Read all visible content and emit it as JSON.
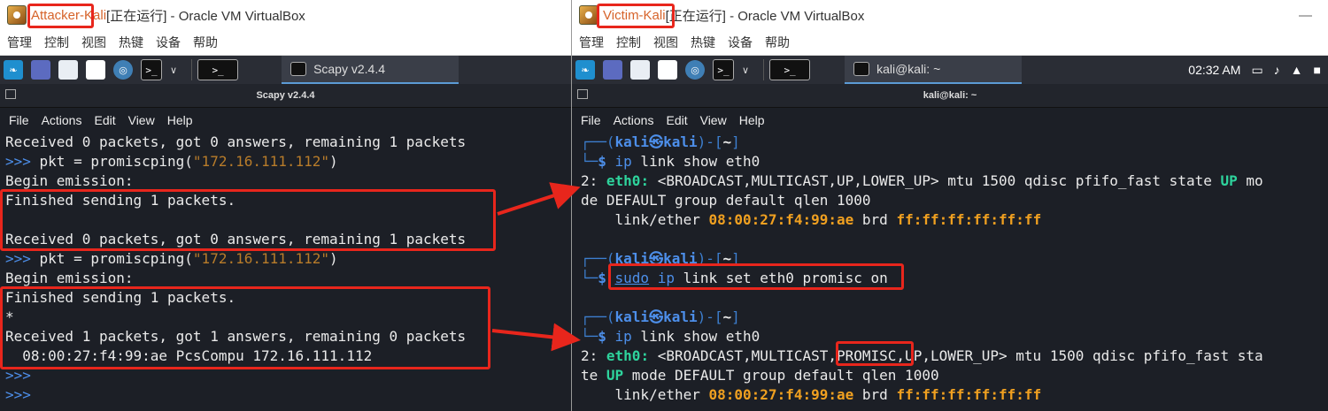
{
  "left": {
    "vm_name": "Attacker-Kali",
    "title_rest": " [正在运行] - Oracle VM VirtualBox",
    "menu": [
      "管理",
      "控制",
      "视图",
      "热键",
      "设备",
      "帮助"
    ],
    "task_label": "Scapy v2.4.4",
    "term_title": "Scapy v2.4.4",
    "term_menu": [
      "File",
      "Actions",
      "Edit",
      "View",
      "Help"
    ],
    "lines": {
      "l1": "Received 0 packets, got 0 answers, remaining 1 packets",
      "l2_prompt": ">>> ",
      "l2_a": "pkt = promiscping(",
      "l2_str": "\"172.16.111.112\"",
      "l2_b": ")",
      "l3": "Begin emission:",
      "l4": "Finished sending 1 packets.",
      "l5": "",
      "l6": "Received 0 packets, got 0 answers, remaining 1 packets",
      "l7_prompt": ">>> ",
      "l7_a": "pkt = promiscping(",
      "l7_str": "\"172.16.111.112\"",
      "l7_b": ")",
      "l8": "Begin emission:",
      "l9": "Finished sending 1 packets.",
      "l10": "*",
      "l11": "Received 1 packets, got 1 answers, remaining 0 packets",
      "l12": "  08:00:27:f4:99:ae PcsCompu 172.16.111.112",
      "l13": ">>>",
      "l14": ">>>"
    }
  },
  "right": {
    "vm_name": "Victim-Kali",
    "title_rest": " [正在运行] - Oracle VM VirtualBox",
    "minimize": "—",
    "menu": [
      "管理",
      "控制",
      "视图",
      "热键",
      "设备",
      "帮助"
    ],
    "task_label": "kali@kali: ~",
    "clock": "02:32 AM",
    "term_title": "kali@kali: ~",
    "term_menu": [
      "File",
      "Actions",
      "Edit",
      "View",
      "Help"
    ],
    "prompt_top": "┌──(",
    "prompt_user": "kali㉿kali",
    "prompt_mid": ")-[",
    "prompt_dir": "~",
    "prompt_end": "]",
    "prompt_bottom": "└─",
    "dollar": "$ ",
    "cmd1_ip": "ip",
    "cmd1_rest": " link show eth0",
    "out1_a": "2: ",
    "out1_if": "eth0:",
    "out1_b": " <BROADCAST,MULTICAST,UP,LOWER_UP> mtu 1500 qdisc pfifo_fast state ",
    "out1_up": "UP",
    "out1_c": " mo",
    "out2": "de DEFAULT group default qlen 1000",
    "out3_a": "    link/ether ",
    "out3_mac": "08:00:27:f4:99:ae",
    "out3_b": " brd ",
    "out3_brd": "ff:ff:ff:ff:ff:ff",
    "cmd2_sudo": "sudo",
    "cmd2_ip": "ip",
    "cmd2_rest": " link set eth0 promisc on",
    "out4_a": "2: ",
    "out4_if": "eth0:",
    "out4_b": " <BROADCAST,MULTICAST,PROMISC,UP,LOWER_UP> mtu 1500 qdisc pfifo_fast sta",
    "out5_a": "te ",
    "out5_up": "UP",
    "out5_b": " mode DEFAULT group default qlen 1000"
  }
}
